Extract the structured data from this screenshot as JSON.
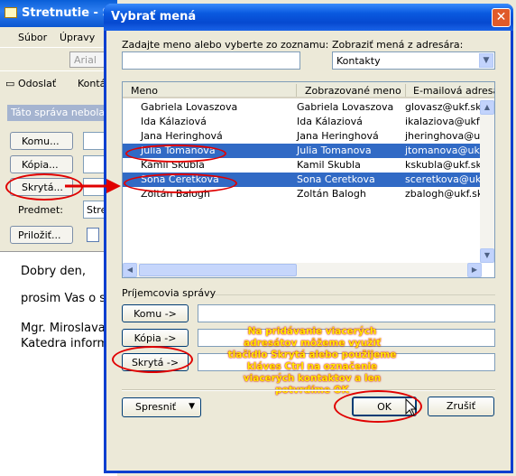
{
  "background_window": {
    "title": "Stretnutie - Sp",
    "menu": [
      "Súbor",
      "Úpravy"
    ],
    "font_value": "Arial",
    "toolbar": {
      "send_label": "Odoslať",
      "contacts_label": "Kontá"
    },
    "info_bar": "Táto správa nebola",
    "buttons": {
      "to": "Komu...",
      "cc": "Kópia...",
      "bcc": "Skrytá...",
      "attach": "Priložiť..."
    },
    "subject_label": "Predmet:",
    "subject_value": "Stre",
    "body_lines": [
      "Dobry den,",
      "prosim Vas o str",
      "Mgr. Miroslava K",
      "Katedra informat"
    ]
  },
  "dialog": {
    "title": "Vybrať mená",
    "close_glyph": "✕",
    "search_label": "Zadajte meno alebo vyberte zo zoznamu:",
    "search_value": "",
    "addressbook_label": "Zobraziť mená z adresára:",
    "addressbook_value": "Kontakty",
    "columns": {
      "name": "Meno",
      "display": "Zobrazované meno",
      "email": "E-mailová adresa"
    },
    "contacts": [
      {
        "name": "Gabriela Lovaszova",
        "display": "Gabriela Lovaszova",
        "email": "glovasz@ukf.sk",
        "selected": false
      },
      {
        "name": "Ida Kálaziová",
        "display": "Ida Kálaziová",
        "email": "ikalaziova@ukf.s",
        "selected": false
      },
      {
        "name": "Jana Heringhová",
        "display": "Jana Heringhová",
        "email": "jheringhova@ukf",
        "selected": false
      },
      {
        "name": "Julia Tomanova",
        "display": "Julia Tomanova",
        "email": "jtomanova@ukf",
        "selected": true
      },
      {
        "name": "Kamil Skubla",
        "display": "Kamil Skubla",
        "email": "kskubla@ukf.sk",
        "selected": false
      },
      {
        "name": "Sona Ceretkova",
        "display": "Sona Ceretkova",
        "email": "sceretkova@ukf",
        "selected": true
      },
      {
        "name": "Zoltán Balogh",
        "display": "Zoltán Balogh",
        "email": "zbalogh@ukf.sk",
        "selected": false
      }
    ],
    "recipients_label": "Príjemcovia správy",
    "to_button": "Komu ->",
    "cc_button": "Kópia ->",
    "bcc_button": "Skrytá ->",
    "annotation": "Na pridávanie viacerých adresátov môžeme využiť tlačidlo Skrytá alebo použijeme kláves Ctrl na označenie viacerých kontaktov a len potvrdíme OK",
    "advanced_button": "Spresniť",
    "ok_button": "OK",
    "cancel_button": "Zrušiť"
  },
  "colors": {
    "selection": "#316ac5",
    "annotation_red": "#e00000",
    "note_yellow": "#ffea00",
    "title_blue": "#0a5ae0"
  }
}
